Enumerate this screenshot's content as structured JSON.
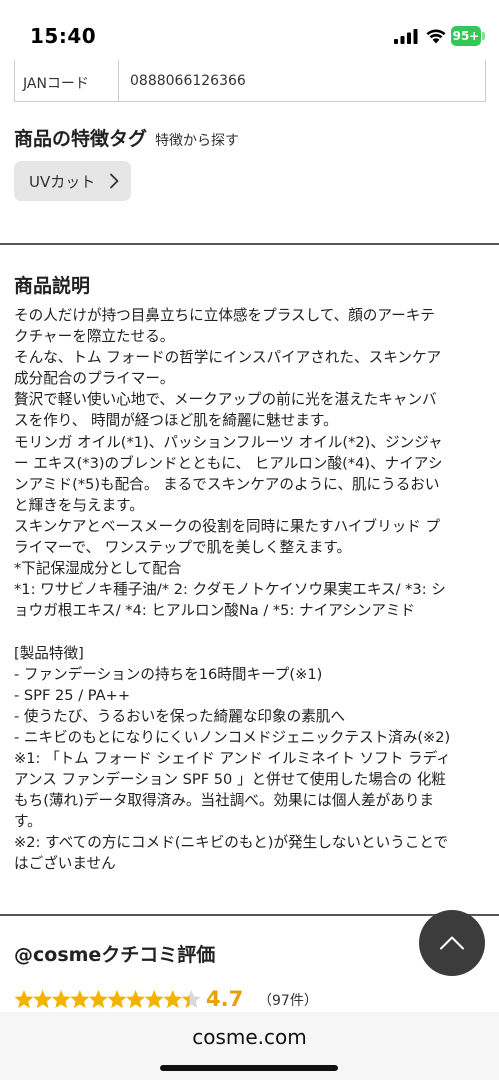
{
  "status_bar": {
    "time": "15:40",
    "battery": "95+"
  },
  "jan": {
    "label": "JANコード",
    "value": "0888066126366"
  },
  "feature_tags": {
    "title": "商品の特徴タグ",
    "subtitle": "特徴から探す",
    "tags": [
      "UVカット"
    ]
  },
  "description": {
    "title": "商品説明",
    "lines": [
      "その人だけが持つ目鼻立ちに立体感をプラスして、顔のアーキテ",
      "クチャーを際立たせる。",
      "そんな、トム フォードの哲学にインスパイアされた、スキンケア",
      "成分配合のプライマー。",
      "贅沢で軽い使い心地で、メークアップの前に光を湛えたキャンバ",
      "スを作り、 時間が経つほど肌を綺麗に魅せます。",
      "モリンガ オイル(*1)、パッションフルーツ オイル(*2)、ジンジャ",
      "ー エキス(*3)のブレンドとともに、 ヒアルロン酸(*4)、ナイアシ",
      "ンアミド(*5)も配合。 まるでスキンケアのように、肌にうるおい",
      "と輝きを与えます。",
      "スキンケアとベースメークの役割を同時に果たすハイブリッド プ",
      "ライマーで、 ワンステップで肌を美しく整えます。",
      "*下記保湿成分として配合",
      "*1: ワサビノキ種子油/* 2: クダモノトケイソウ果実エキス/ *3: シ",
      "ョウガ根エキス/ *4: ヒアルロン酸Na / *5: ナイアシンアミド",
      "",
      "[製品特徴]",
      "- ファンデーションの持ちを16時間キープ(※1)",
      "- SPF 25 / PA++",
      "- 使うたび、うるおいを保った綺麗な印象の素肌へ",
      "- ニキビのもとになりにくいノンコメドジェニックテスト済み(※2)",
      "※1: 「トム フォード シェイド アンド イルミネイト ソフト ラディ",
      "アンス ファンデーション SPF 50 」と併せて使用した場合の 化粧",
      "もち(薄れ)データ取得済み。当社調べ。効果には個人差がありま",
      "す。",
      "※2: すべての方にコメド(ニキビのもと)が発生しないということで",
      "はございません"
    ]
  },
  "review": {
    "title": "@cosmeクチコミ評価",
    "rating": "4.7",
    "rating_fraction": 0.94,
    "count": "（97件）"
  },
  "url_bar": {
    "url": "cosme.com"
  },
  "colors": {
    "star": "#f2b400",
    "star_empty": "#d9d9d9",
    "battery": "#34c759"
  }
}
